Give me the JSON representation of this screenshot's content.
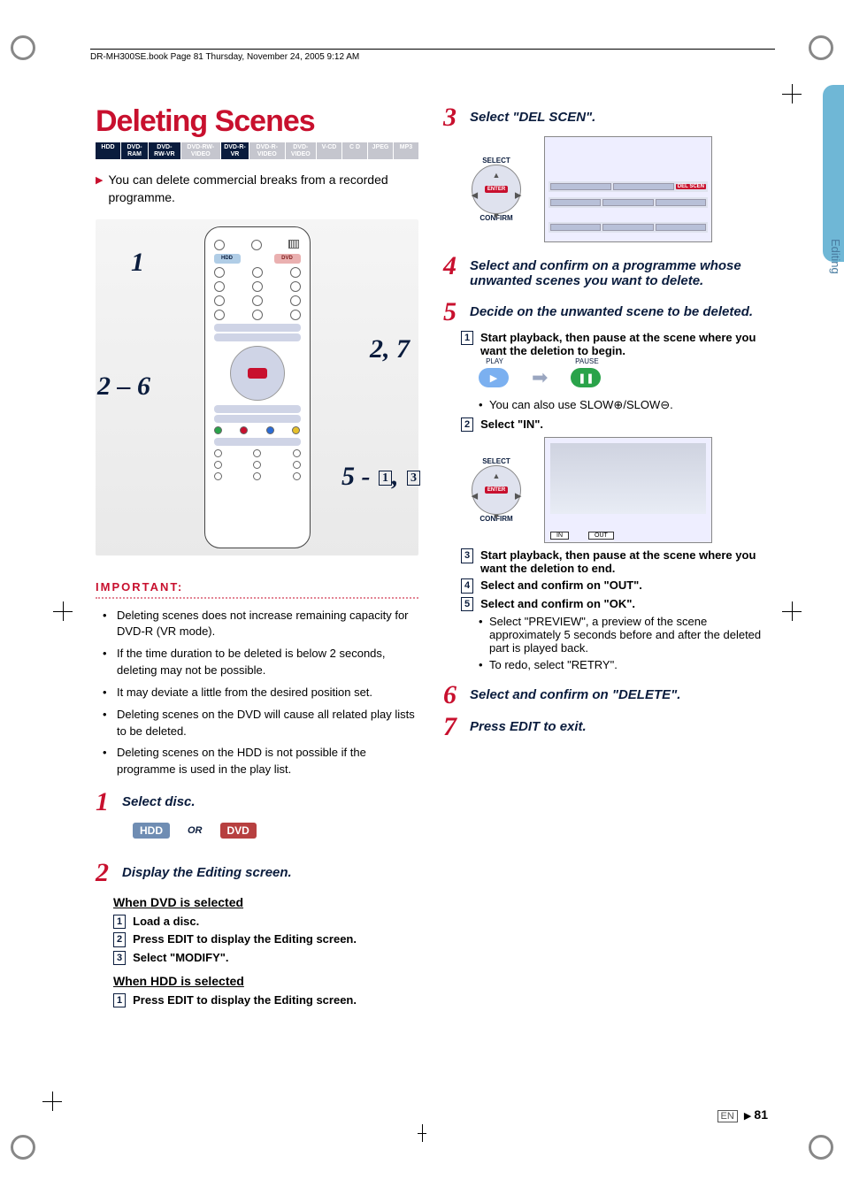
{
  "header": "DR-MH300SE.book  Page 81  Thursday, November 24, 2005  9:12 AM",
  "title": "Deleting Scenes",
  "formats": [
    "HDD",
    "DVD-RAM",
    "DVD-RW-VR",
    "DVD-RW-VIDEO",
    "DVD-R-VR",
    "DVD-R-VIDEO",
    "DVD-VIDEO",
    "V-CD",
    "C D",
    "JPEG",
    "MP3"
  ],
  "format_active": [
    true,
    true,
    true,
    false,
    true,
    false,
    false,
    false,
    false,
    false,
    false
  ],
  "intro": "You can delete commercial breaks from a recorded programme.",
  "remote_callouts": {
    "c1": "1",
    "c27": "2, 7",
    "c26": "2 – 6",
    "c5": "5",
    "c5_boxes": [
      "1",
      "3"
    ]
  },
  "important_hdr": "IMPORTANT:",
  "important": [
    "Deleting scenes does not increase remaining capacity for DVD-R (VR mode).",
    "If the time duration to be deleted is below 2 seconds, deleting may not be possible.",
    "It may deviate a little from the desired position set.",
    "Deleting scenes on the DVD will cause all related play lists to be deleted.",
    "Deleting scenes on the HDD is not possible if the programme is used in the play list."
  ],
  "step1": {
    "num": "1",
    "text": "Select disc."
  },
  "select_disc": {
    "hdd": "HDD",
    "or": "OR",
    "dvd": "DVD"
  },
  "step2": {
    "num": "2",
    "text": "Display the Editing screen."
  },
  "dvd_sel_hdr": "When DVD is selected",
  "dvd_sel_steps": [
    {
      "n": "1",
      "t": "Load a disc."
    },
    {
      "n": "2",
      "t": "Press EDIT to display the Editing screen."
    },
    {
      "n": "3",
      "t": "Select \"MODIFY\"."
    }
  ],
  "hdd_sel_hdr": "When HDD is selected",
  "hdd_sel_steps": [
    {
      "n": "1",
      "t": "Press EDIT to display the Editing screen."
    }
  ],
  "step3": {
    "num": "3",
    "text": "Select \"DEL SCEN\"."
  },
  "dpad": {
    "select": "SELECT",
    "enter": "ENTER",
    "confirm": "CONFIRM"
  },
  "del_scen_label": "DEL SCEN",
  "step4": {
    "num": "4",
    "text": "Select and confirm on a programme whose unwanted scenes you want to delete."
  },
  "step5": {
    "num": "5",
    "text": "Decide on the unwanted scene to be deleted."
  },
  "step5_sub1": {
    "n": "1",
    "t": "Start playback, then pause at the scene where you want the deletion to begin."
  },
  "play_label": "PLAY",
  "pause_label": "PAUSE",
  "slow_note": "You can also use SLOW⊕/SLOW⊖.",
  "step5_sub2": {
    "n": "2",
    "t": "Select \"IN\"."
  },
  "in_label": "IN",
  "out_label": "OUT",
  "step5_sub3": {
    "n": "3",
    "t": "Start playback, then pause at the scene where you want the deletion to end."
  },
  "step5_sub4": {
    "n": "4",
    "t": "Select and confirm on \"OUT\"."
  },
  "step5_sub5": {
    "n": "5",
    "t": "Select and confirm on \"OK\"."
  },
  "preview_bullets": [
    "Select \"PREVIEW\", a preview of the scene approximately 5 seconds before and after the deleted part is played back.",
    "To redo, select \"RETRY\"."
  ],
  "step6": {
    "num": "6",
    "text": "Select and confirm on \"DELETE\"."
  },
  "step7": {
    "num": "7",
    "text": "Press EDIT to exit."
  },
  "side_tab": "Editing",
  "footer": {
    "lang": "EN",
    "arrow": "▶",
    "page": "81"
  }
}
